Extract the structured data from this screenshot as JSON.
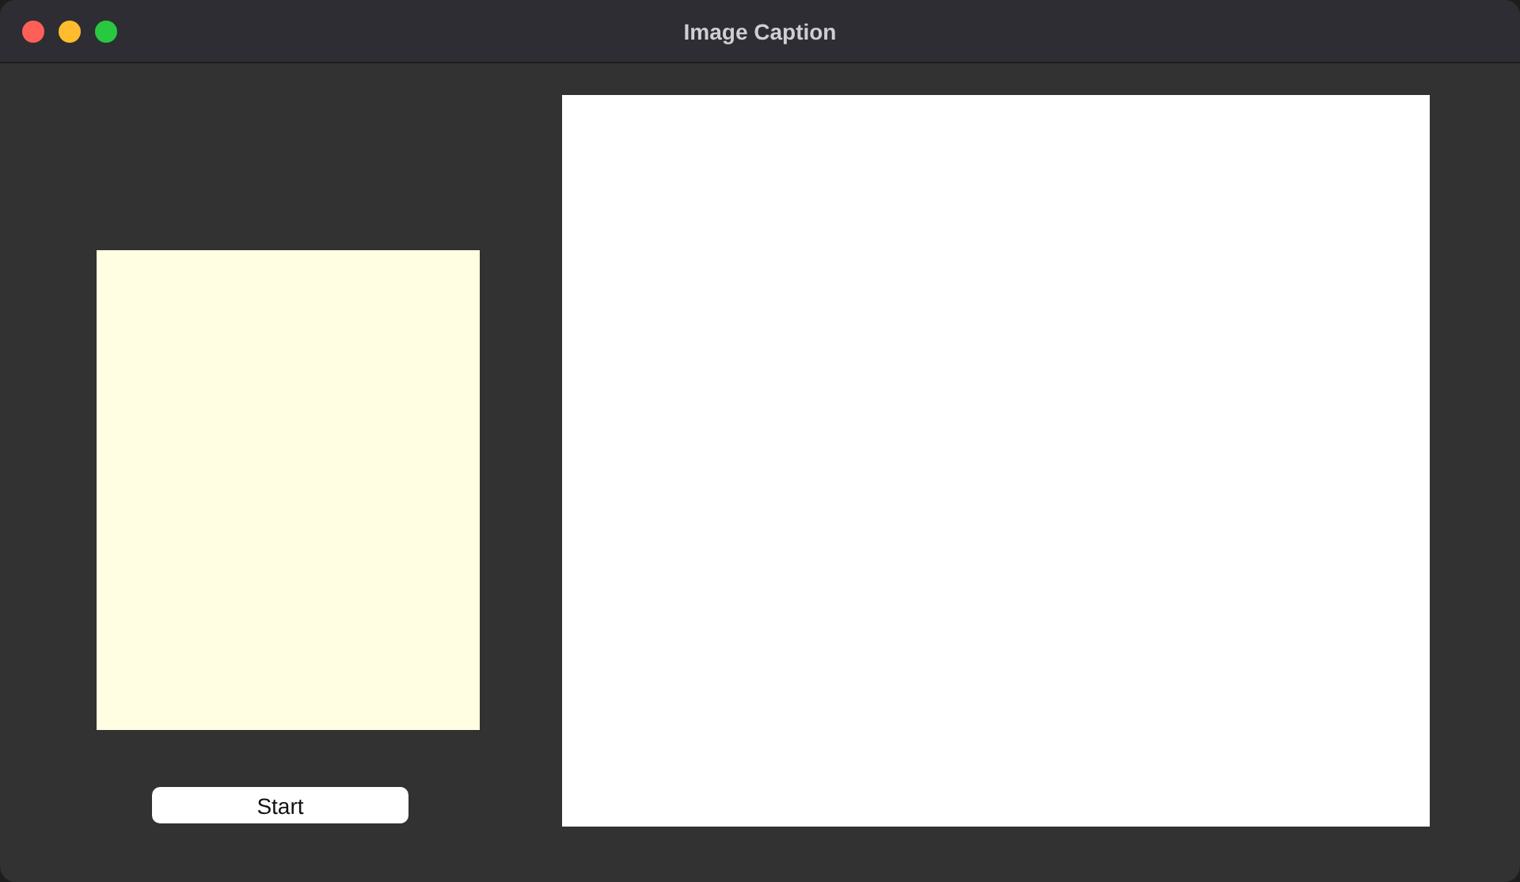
{
  "window": {
    "title": "Image Caption"
  },
  "start_button": {
    "label": "Start"
  }
}
